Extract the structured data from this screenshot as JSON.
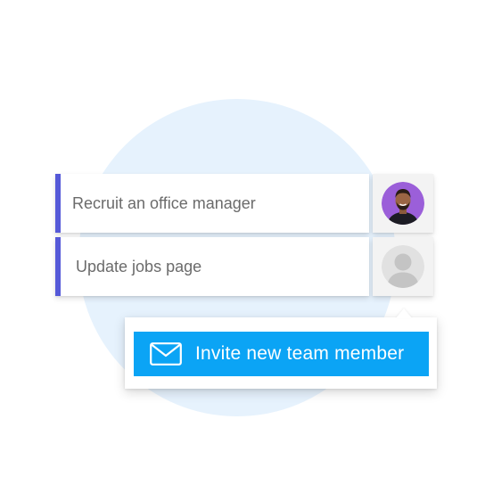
{
  "tasks": [
    {
      "label": "Recruit an office manager",
      "assignee": "user-photo"
    },
    {
      "label": "Update jobs page",
      "assignee": "unassigned"
    }
  ],
  "invite": {
    "label": "Invite new team member",
    "icon": "envelope-icon"
  },
  "colors": {
    "accent_bar": "#5559d8",
    "invite_button": "#0ba4f5",
    "background_circle": "#e6f2fd",
    "avatar_bg": "#9b5fd9"
  }
}
